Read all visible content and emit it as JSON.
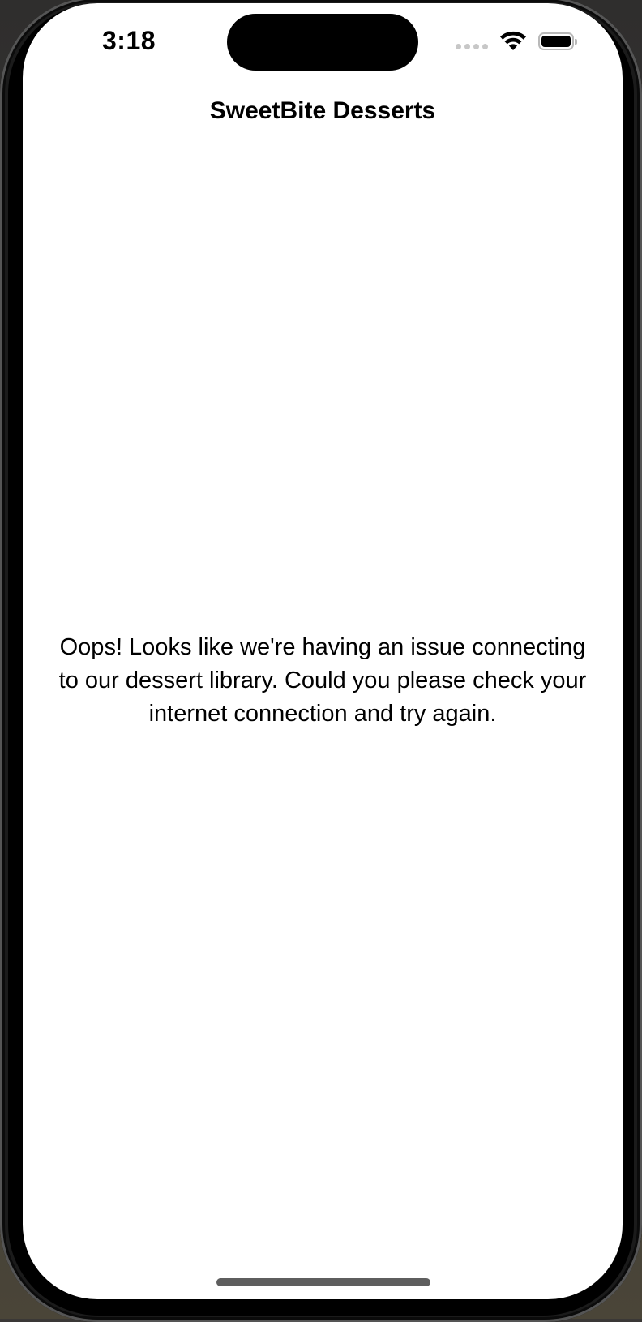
{
  "status_bar": {
    "time": "3:18",
    "icons": [
      "cellular-signal-icon",
      "wifi-icon",
      "battery-icon"
    ],
    "battery_level": 1.0
  },
  "nav": {
    "title": "SweetBite Desserts"
  },
  "main": {
    "error_message": "Oops! Looks like we're having an issue connecting to our dessert library. Could you please check your internet connection and try again."
  },
  "colors": {
    "background": "#ffffff",
    "text": "#000000",
    "home_indicator": "#5e5e5e"
  }
}
